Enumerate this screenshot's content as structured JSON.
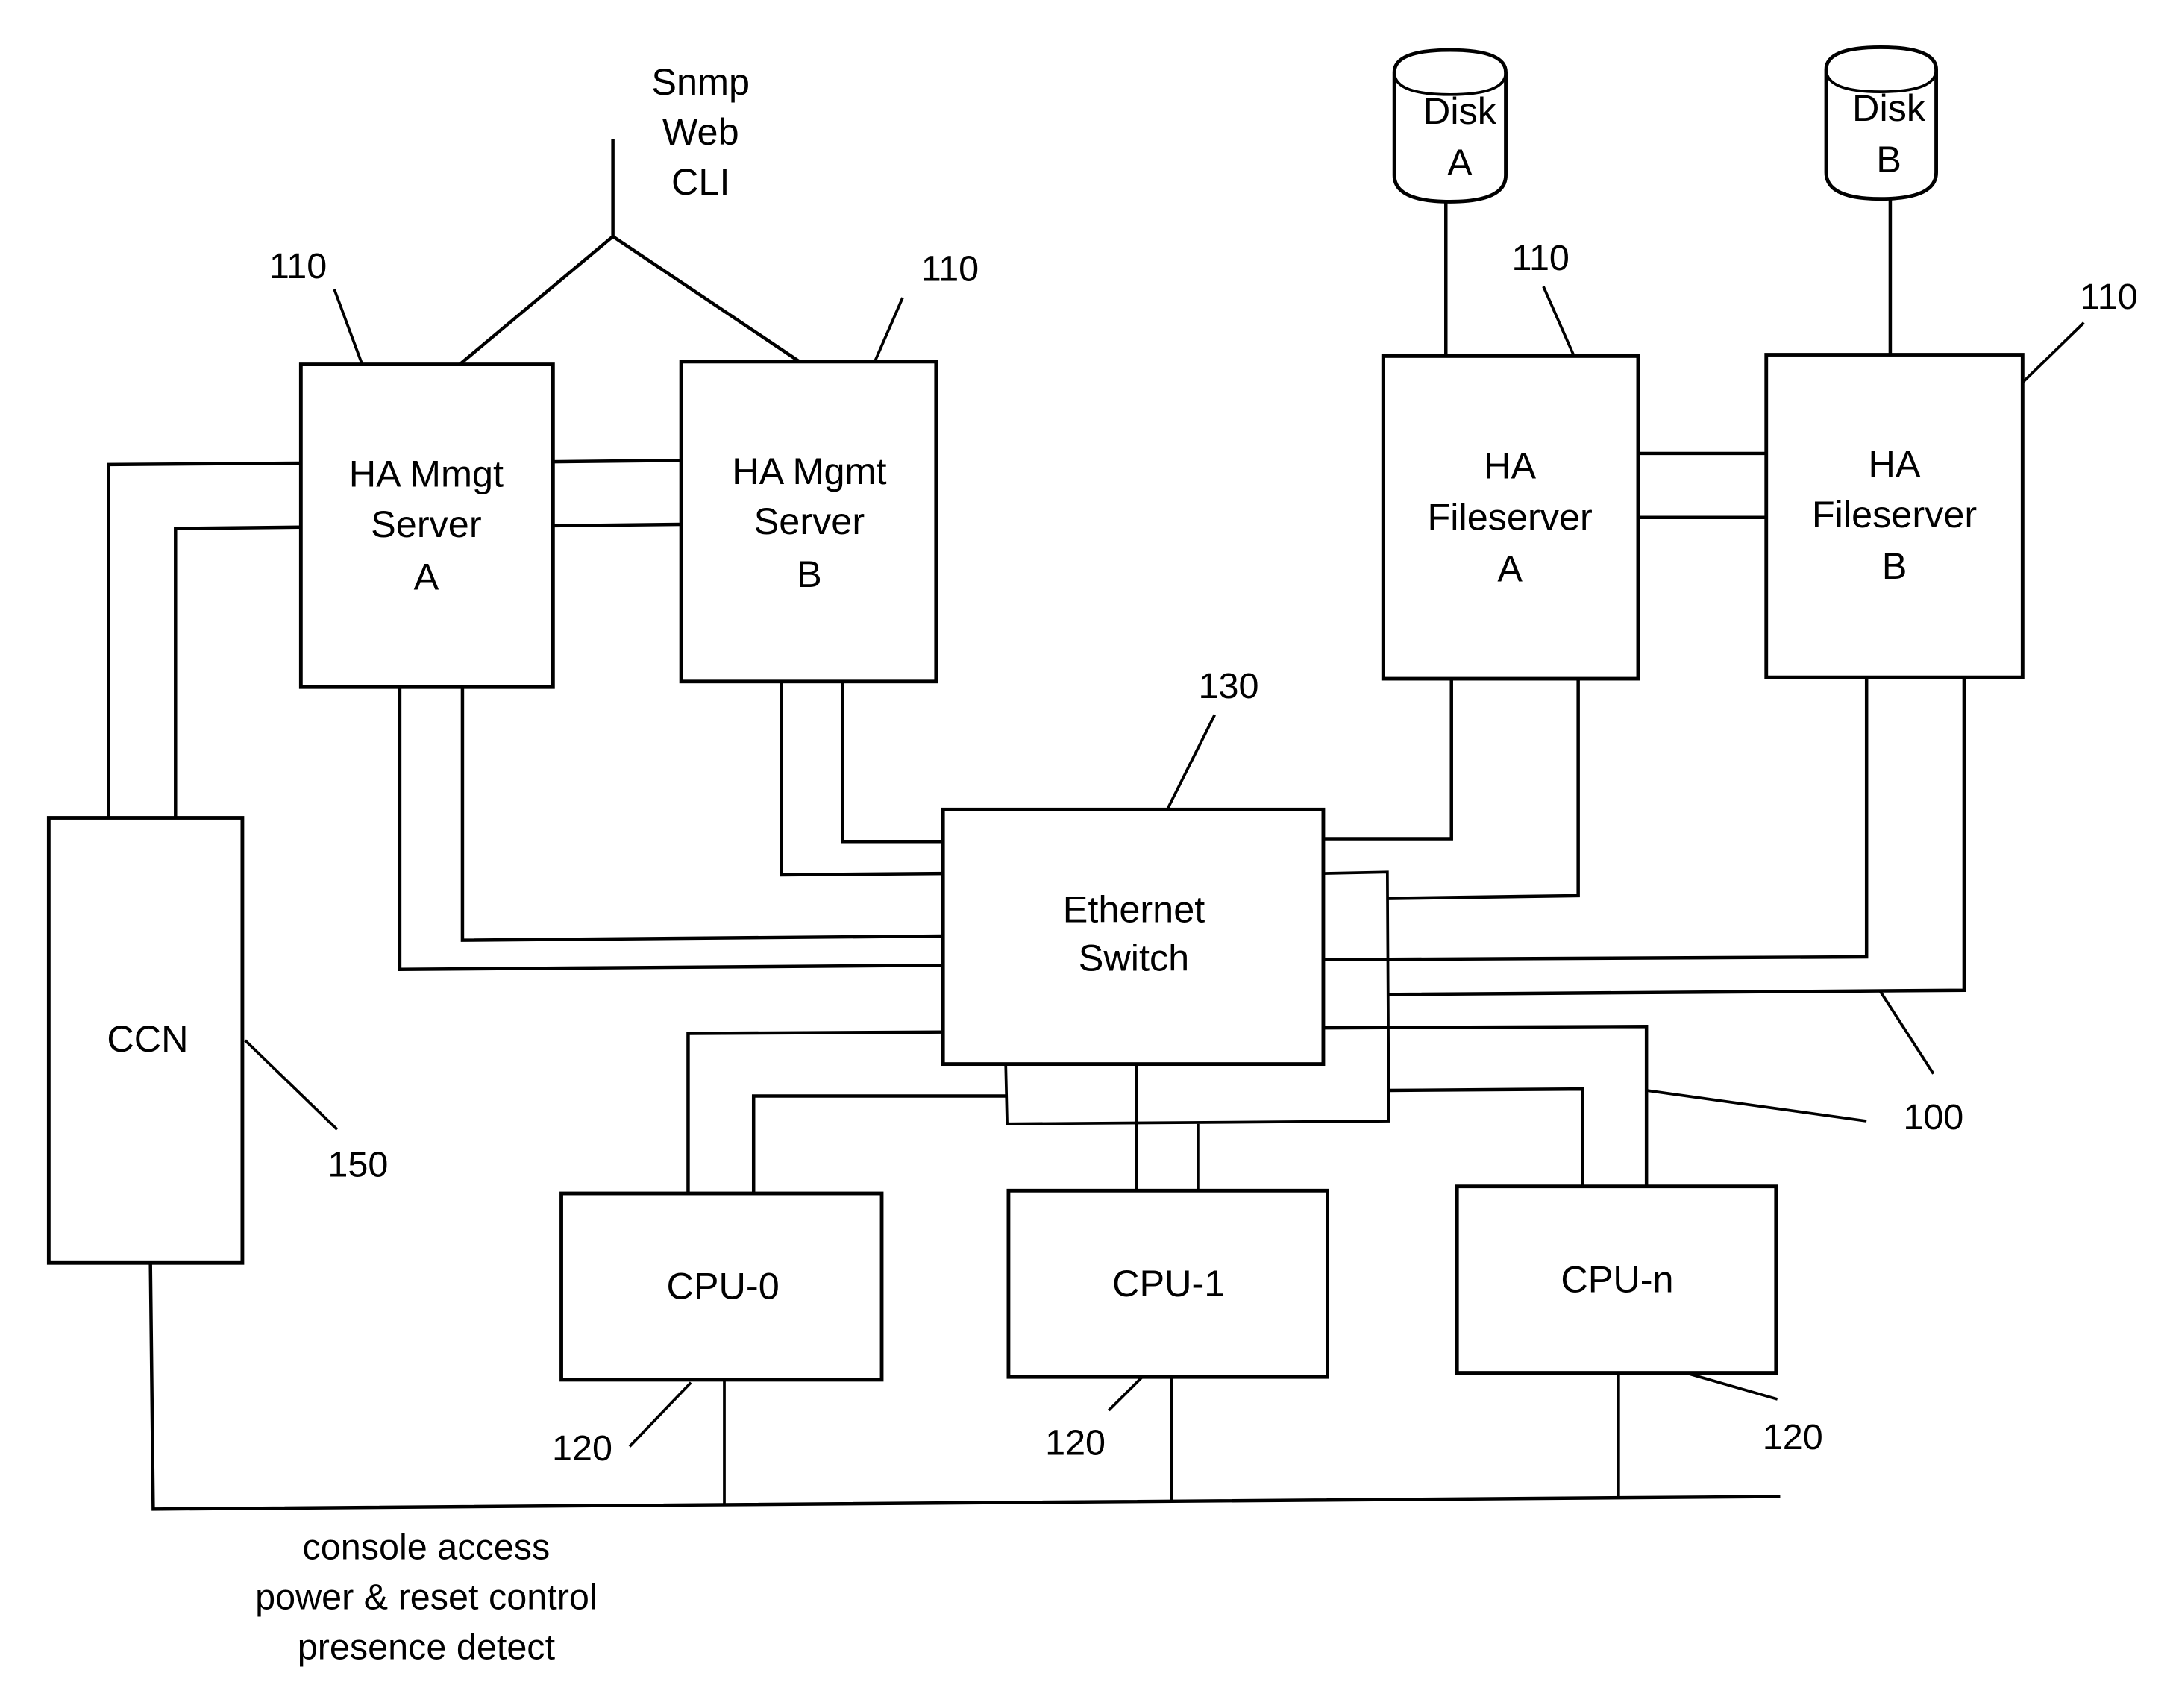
{
  "diagram": {
    "external_interfaces": [
      "Snmp",
      "Web",
      "CLI"
    ],
    "nodes": {
      "mgmt_a": {
        "lines": [
          "HA Mmgt",
          "Server",
          "A"
        ],
        "ref": "110"
      },
      "mgmt_b": {
        "lines": [
          "HA Mgmt",
          "Server",
          "B"
        ],
        "ref": "110"
      },
      "fs_a": {
        "lines": [
          "HA",
          "Fileserver",
          "A"
        ],
        "ref": "110"
      },
      "fs_b": {
        "lines": [
          "HA",
          "Fileserver",
          "B"
        ],
        "ref": "110"
      },
      "disk_a": {
        "lines": [
          "Disk",
          "A"
        ]
      },
      "disk_b": {
        "lines": [
          "Disk",
          "B"
        ]
      },
      "switch": {
        "lines": [
          "Ethernet",
          "Switch"
        ],
        "ref": "130"
      },
      "ccn": {
        "lines": [
          "CCN"
        ],
        "ref": "150"
      },
      "cpu0": {
        "lines": [
          "CPU-0"
        ],
        "ref": "120"
      },
      "cpu1": {
        "lines": [
          "CPU-1"
        ],
        "ref": "120"
      },
      "cpun": {
        "lines": [
          "CPU-n"
        ],
        "ref": "120"
      }
    },
    "network_ref": "100",
    "bus_notes": [
      "console access",
      "power & reset control",
      "presence detect"
    ]
  }
}
